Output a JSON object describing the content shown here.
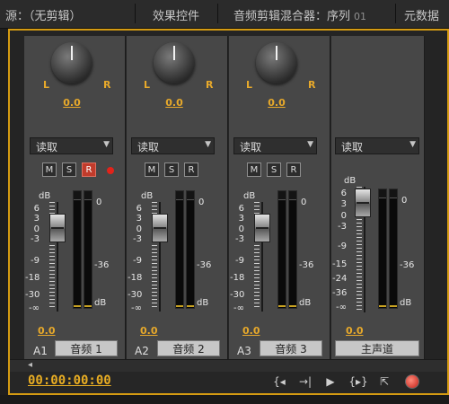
{
  "tabs": [
    {
      "label": "源：（无剪辑）",
      "sub": ""
    },
    {
      "label": "效果控件",
      "sub": ""
    },
    {
      "label": "音频剪辑混合器：序列",
      "sub": "01"
    },
    {
      "label": "元数据",
      "sub": ""
    }
  ],
  "strips": [
    {
      "pan_value": "0.0",
      "pan_L": "L",
      "pan_R": "R",
      "mode": "读取",
      "btn_m": "M",
      "btn_s": "S",
      "btn_r": "R",
      "rec_active": true,
      "volume": "0.0",
      "track_id": "A1",
      "track_name": "音频 1"
    },
    {
      "pan_value": "0.0",
      "pan_L": "L",
      "pan_R": "R",
      "mode": "读取",
      "btn_m": "M",
      "btn_s": "S",
      "btn_r": "R",
      "rec_active": false,
      "volume": "0.0",
      "track_id": "A2",
      "track_name": "音频 2"
    },
    {
      "pan_value": "0.0",
      "pan_L": "L",
      "pan_R": "R",
      "mode": "读取",
      "btn_m": "M",
      "btn_s": "S",
      "btn_r": "R",
      "rec_active": false,
      "volume": "0.0",
      "track_id": "A3",
      "track_name": "音频 3"
    },
    {
      "mode": "读取",
      "volume": "0.0",
      "track_name": "主声道"
    }
  ],
  "scale_left": [
    "dB",
    "6",
    "3",
    "0",
    "-3",
    "-9",
    "-18",
    "-30",
    "-∞"
  ],
  "master_scale_left": [
    "dB",
    "6",
    "3",
    "0",
    "-3",
    "-9",
    "-15",
    "-24",
    "-36",
    "-∞"
  ],
  "meter_scale": [
    "0",
    "-36",
    "dB"
  ],
  "timecode": "00:00:00:00",
  "transport_icons": [
    "go-to-in-icon",
    "go-to-out-icon",
    "play-icon",
    "play-in-to-out-icon",
    "loop-icon",
    "record-icon"
  ],
  "transport_glyphs": [
    "{◂",
    "→|",
    "▶",
    "{▸}",
    "⇱"
  ],
  "colors": {
    "accent": "#e7a92b",
    "panel_border": "#d59b12",
    "record": "#c21e16"
  }
}
